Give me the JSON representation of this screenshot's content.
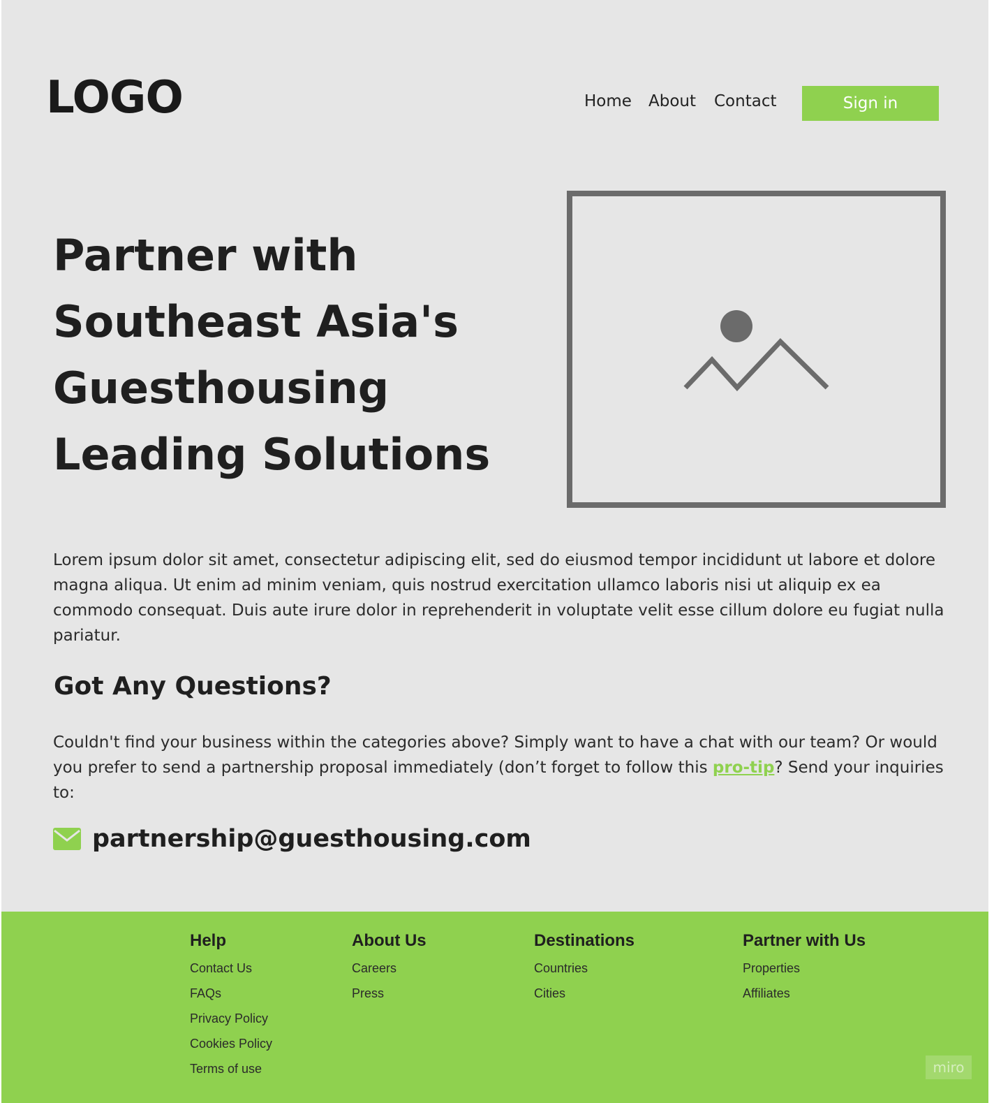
{
  "header": {
    "logo_text": "LOGO",
    "nav": [
      "Home",
      "About",
      "Contact"
    ],
    "signin_label": "Sign in"
  },
  "hero": {
    "title_lines": [
      "Partner with",
      "Southeast Asia's",
      "Guesthousing",
      "Leading Solutions"
    ],
    "image_icon": "image-placeholder-icon"
  },
  "intro": {
    "paragraph": "Lorem ipsum dolor sit amet, consectetur adipiscing elit, sed do eiusmod tempor incididunt ut labore et dolore magna aliqua. Ut enim ad minim veniam, quis nostrud exercitation ullamco laboris nisi ut aliquip ex ea commodo consequat. Duis aute irure dolor in reprehenderit in voluptate velit esse cillum dolore eu fugiat nulla pariatur."
  },
  "questions": {
    "title": "Got Any Questions?",
    "text_before": "Couldn't find your business within the categories above? Simply want to have a chat with our team? Or would you prefer to send a partnership proposal immediately (don’t forget to follow this ",
    "link_text": "pro-tip",
    "text_after": "? Send your inquiries to:",
    "email": "partnership@guesthousing.com",
    "email_icon": "envelope-icon"
  },
  "footer": {
    "columns": [
      {
        "heading": "Help",
        "links": [
          "Contact Us",
          "FAQs",
          "Privacy Policy",
          "Cookies Policy",
          "Terms of use"
        ]
      },
      {
        "heading": "About Us",
        "links": [
          "Careers",
          "Press"
        ]
      },
      {
        "heading": "Destinations",
        "links": [
          "Countries",
          "Cities"
        ]
      },
      {
        "heading": "Partner with Us",
        "links": [
          "Properties",
          "Affiliates"
        ]
      }
    ]
  },
  "watermark": "miro",
  "colors": {
    "accent": "#8fd14f",
    "background": "#e6e6e6",
    "placeholder_stroke": "#6b6b6b",
    "text": "#1f1f1f"
  }
}
